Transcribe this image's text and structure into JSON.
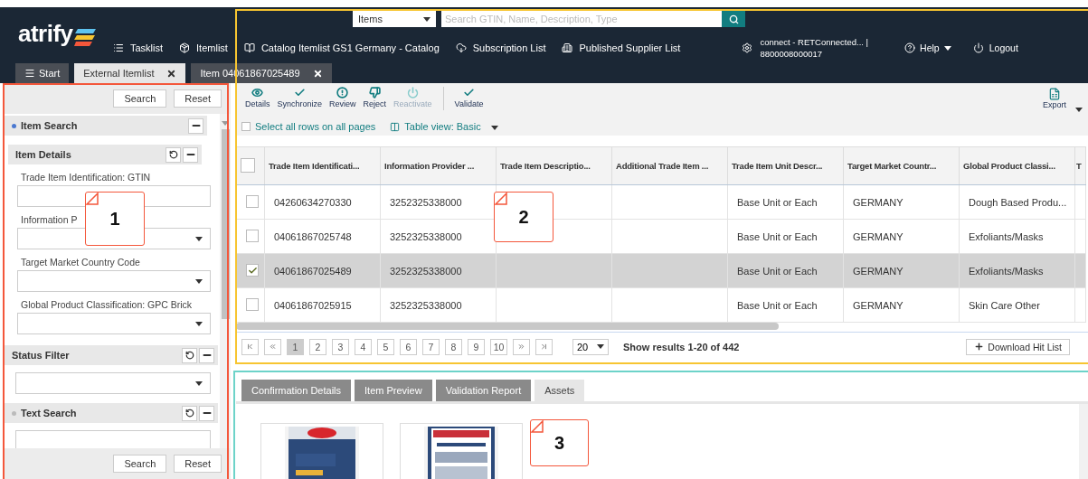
{
  "header": {
    "logo": "atrify",
    "search": {
      "scope": "Items",
      "placeholder": "Search GTIN, Name, Description, Type"
    },
    "nav": [
      {
        "label": "Tasklist"
      },
      {
        "label": "Itemlist"
      },
      {
        "label": "Catalog Itemlist GS1 Germany - Catalog"
      },
      {
        "label": "Subscription List"
      },
      {
        "label": "Published Supplier List"
      }
    ],
    "account": {
      "line_1": "connect - RETConnected... |",
      "line_2": "8800008000017"
    },
    "help": "Help",
    "logout": "Logout"
  },
  "tabs": [
    {
      "label": "Start",
      "kind": "menu",
      "selected": false
    },
    {
      "label": "External Itemlist",
      "kind": "closable",
      "selected": true
    },
    {
      "label": "Item 04061867025489",
      "kind": "closable",
      "selected": false
    }
  ],
  "search_panel": {
    "buttons": [
      "Search",
      "Reset"
    ],
    "item_search": {
      "title": "Item Search",
      "active": true,
      "details": {
        "title": "Item Details",
        "fields": [
          {
            "label": "Trade Item Identification: GTIN",
            "kind": "text"
          },
          {
            "label": "Information P",
            "kind": "select"
          },
          {
            "label": "Target Market Country Code",
            "kind": "select"
          },
          {
            "label": "Global Product Classification: GPC Brick",
            "kind": "select"
          }
        ]
      }
    },
    "status_filter": {
      "title": "Status Filter"
    },
    "text_search": {
      "title": "Text Search",
      "active": false
    },
    "bottom_buttons": [
      "Search",
      "Reset"
    ]
  },
  "toolbar": {
    "actions": [
      {
        "label": "Details",
        "disabled": false
      },
      {
        "label": "Synchronize",
        "disabled": false
      },
      {
        "label": "Review",
        "disabled": false
      },
      {
        "label": "Reject",
        "disabled": false
      },
      {
        "label": "Reactivate",
        "disabled": true
      },
      {
        "label": "Validate",
        "disabled": false
      }
    ],
    "export": "Export",
    "select_all": {
      "label": "Select all rows on all pages",
      "checked": false
    },
    "table_view": "Table view: Basic"
  },
  "table": {
    "all_checked": false,
    "columns": [
      "Trade Item Identificati...",
      "Information Provider ...",
      "Trade Item Descriptio...",
      "Additional Trade Item ...",
      "Trade Item Unit Descr...",
      "Target Market Countr...",
      "Global Product Classi...",
      "T"
    ],
    "rows": [
      {
        "selected": false,
        "cells": [
          "04260634270330",
          "3252325338000",
          "",
          "",
          "Base Unit or Each",
          "GERMANY",
          "Dough Based Produ..."
        ]
      },
      {
        "selected": false,
        "cells": [
          "04061867025748",
          "3252325338000",
          "",
          "",
          "Base Unit or Each",
          "GERMANY",
          "Exfoliants/Masks"
        ]
      },
      {
        "selected": true,
        "cells": [
          "04061867025489",
          "3252325338000",
          "",
          "",
          "Base Unit or Each",
          "GERMANY",
          "Exfoliants/Masks"
        ]
      },
      {
        "selected": false,
        "cells": [
          "04061867025915",
          "3252325338000",
          "",
          "",
          "Base Unit or Each",
          "GERMANY",
          "Skin Care Other"
        ]
      }
    ]
  },
  "pagination": {
    "pages": [
      {
        "label": "1",
        "selected": true
      },
      {
        "label": "2",
        "selected": false
      },
      {
        "label": "3",
        "selected": false
      },
      {
        "label": "4",
        "selected": false
      },
      {
        "label": "5",
        "selected": false
      },
      {
        "label": "6",
        "selected": false
      },
      {
        "label": "7",
        "selected": false
      },
      {
        "label": "8",
        "selected": false
      },
      {
        "label": "9",
        "selected": false
      },
      {
        "label": "10",
        "selected": false
      }
    ],
    "page_size": "20",
    "summary": "Show results 1-20 of 442",
    "download": "Download Hit List"
  },
  "detail_tabs": [
    {
      "label": "Confirmation Details",
      "selected": false
    },
    {
      "label": "Item Preview",
      "selected": false
    },
    {
      "label": "Validation Report",
      "selected": false
    },
    {
      "label": "Assets",
      "selected": true
    }
  ],
  "annotations": [
    {
      "label": "1",
      "color": "#f4573b"
    },
    {
      "label": "2",
      "color": "#f7c531"
    },
    {
      "label": "3",
      "color": "#6dd3c9"
    }
  ]
}
